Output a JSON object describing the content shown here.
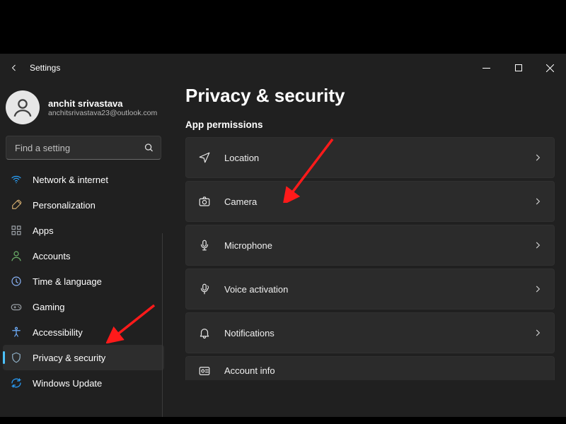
{
  "window": {
    "title": "Settings"
  },
  "profile": {
    "name": "anchit srivastava",
    "email": "anchitsrivastava23@outlook.com"
  },
  "search": {
    "placeholder": "Find a setting"
  },
  "sidebar": {
    "items": [
      {
        "label": "Network & internet",
        "icon": "wifi"
      },
      {
        "label": "Personalization",
        "icon": "brush"
      },
      {
        "label": "Apps",
        "icon": "apps"
      },
      {
        "label": "Accounts",
        "icon": "person"
      },
      {
        "label": "Time & language",
        "icon": "clock"
      },
      {
        "label": "Gaming",
        "icon": "gaming"
      },
      {
        "label": "Accessibility",
        "icon": "accessibility"
      },
      {
        "label": "Privacy & security",
        "icon": "shield"
      },
      {
        "label": "Windows Update",
        "icon": "update"
      }
    ],
    "selected_index": 7
  },
  "main": {
    "heading": "Privacy & security",
    "section": "App permissions",
    "tiles": [
      {
        "label": "Location",
        "icon": "location"
      },
      {
        "label": "Camera",
        "icon": "camera"
      },
      {
        "label": "Microphone",
        "icon": "microphone"
      },
      {
        "label": "Voice activation",
        "icon": "voice"
      },
      {
        "label": "Notifications",
        "icon": "bell"
      },
      {
        "label": "Account info",
        "icon": "account"
      }
    ]
  }
}
